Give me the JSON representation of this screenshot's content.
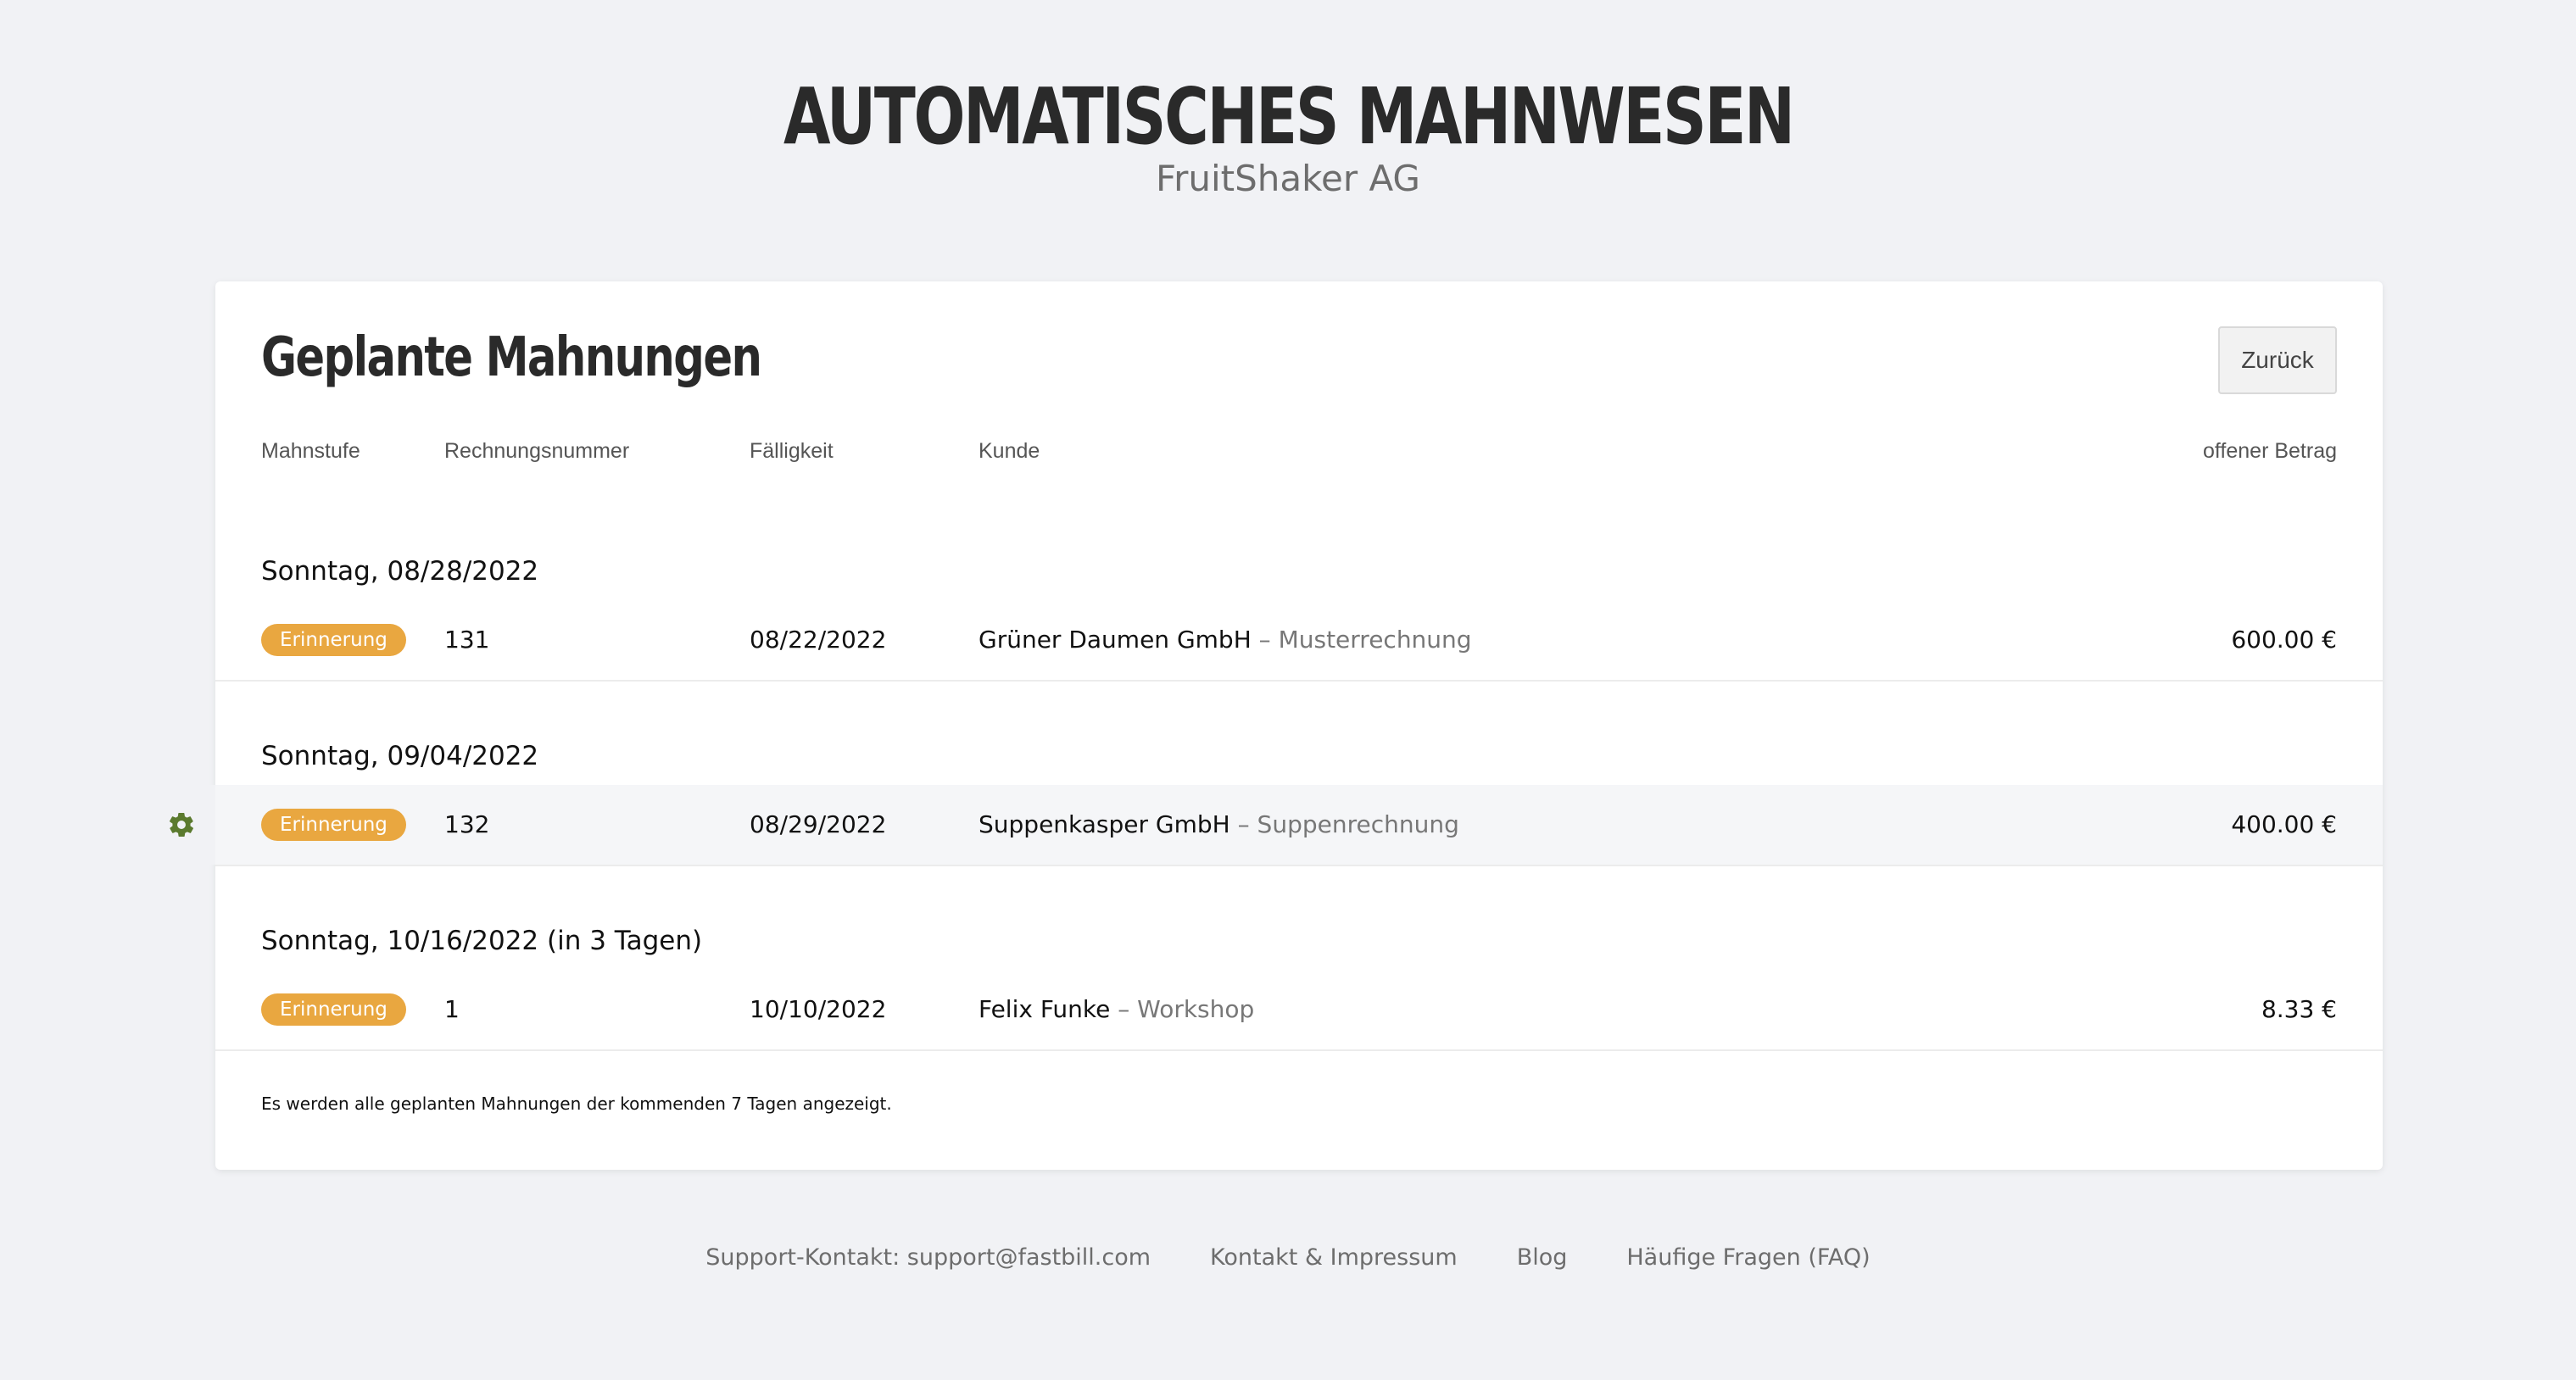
{
  "header": {
    "title": "AUTOMATISCHES MAHNWESEN",
    "company": "FruitShaker AG"
  },
  "card": {
    "title": "Geplante Mahnungen",
    "back_label": "Zurück",
    "columns": [
      "Mahnstufe",
      "Rechnungsnummer",
      "Fälligkeit",
      "Kunde",
      "offener Betrag"
    ],
    "groups": [
      {
        "date": "Sonntag, 08/28/2022",
        "row": {
          "level": "Erinnerung",
          "invoice": "131",
          "due": "08/22/2022",
          "customer": "Grüner Daumen GmbH",
          "separator": " – ",
          "description": "Musterrechnung",
          "amount": "600.00 €"
        }
      },
      {
        "date": "Sonntag, 09/04/2022",
        "row": {
          "level": "Erinnerung",
          "invoice": "132",
          "due": "08/29/2022",
          "customer": "Suppenkasper GmbH",
          "separator": " – ",
          "description": "Suppenrechnung",
          "amount": "400.00 €"
        }
      },
      {
        "date": "Sonntag, 10/16/2022 (in 3 Tagen)",
        "row": {
          "level": "Erinnerung",
          "invoice": "1",
          "due": "10/10/2022",
          "customer": "Felix Funke",
          "separator": " – ",
          "description": "Workshop",
          "amount": "8.33 €"
        }
      }
    ],
    "note": "Es werden alle geplanten Mahnungen der kommenden 7 Tagen angezeigt."
  },
  "footer": {
    "links": [
      "Support-Kontakt: support@fastbill.com",
      "Kontakt & Impressum",
      "Blog",
      "Häufige Fragen (FAQ)"
    ]
  },
  "colors": {
    "badge": "#e9a740",
    "gear": "#5b7a2e",
    "background": "#f1f2f5"
  },
  "icons": {
    "row_action": "gear-icon"
  }
}
